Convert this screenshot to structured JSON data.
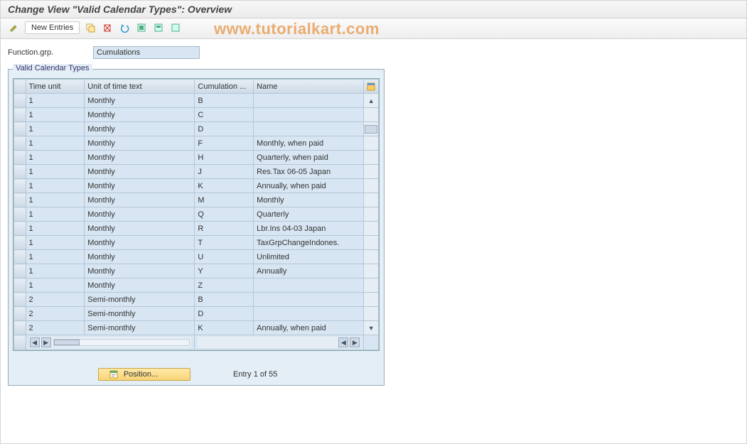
{
  "title": "Change View \"Valid Calendar Types\": Overview",
  "toolbar": {
    "new_entries": "New Entries"
  },
  "watermark": "www.tutorialkart.com",
  "field": {
    "label": "Function.grp.",
    "value": "Cumulations"
  },
  "groupbox_title": "Valid Calendar Types",
  "columns": {
    "time_unit": "Time unit",
    "unit_text": "Unit of time text",
    "cumulation": "Cumulation ...",
    "name": "Name"
  },
  "rows": [
    {
      "tu": "1",
      "ut": "Monthly",
      "cu": "B",
      "nm": ""
    },
    {
      "tu": "1",
      "ut": "Monthly",
      "cu": "C",
      "nm": ""
    },
    {
      "tu": "1",
      "ut": "Monthly",
      "cu": "D",
      "nm": ""
    },
    {
      "tu": "1",
      "ut": "Monthly",
      "cu": "F",
      "nm": "Monthly, when paid"
    },
    {
      "tu": "1",
      "ut": "Monthly",
      "cu": "H",
      "nm": "Quarterly, when paid"
    },
    {
      "tu": "1",
      "ut": "Monthly",
      "cu": "J",
      "nm": "Res.Tax 06-05  Japan"
    },
    {
      "tu": "1",
      "ut": "Monthly",
      "cu": "K",
      "nm": "Annually, when paid"
    },
    {
      "tu": "1",
      "ut": "Monthly",
      "cu": "M",
      "nm": "Monthly"
    },
    {
      "tu": "1",
      "ut": "Monthly",
      "cu": "Q",
      "nm": "Quarterly"
    },
    {
      "tu": "1",
      "ut": "Monthly",
      "cu": "R",
      "nm": "Lbr.Ins 04-03  Japan"
    },
    {
      "tu": "1",
      "ut": "Monthly",
      "cu": "T",
      "nm": "TaxGrpChangeIndones."
    },
    {
      "tu": "1",
      "ut": "Monthly",
      "cu": "U",
      "nm": "Unlimited"
    },
    {
      "tu": "1",
      "ut": "Monthly",
      "cu": "Y",
      "nm": "Annually"
    },
    {
      "tu": "1",
      "ut": "Monthly",
      "cu": "Z",
      "nm": ""
    },
    {
      "tu": "2",
      "ut": "Semi-monthly",
      "cu": "B",
      "nm": ""
    },
    {
      "tu": "2",
      "ut": "Semi-monthly",
      "cu": "D",
      "nm": ""
    },
    {
      "tu": "2",
      "ut": "Semi-monthly",
      "cu": "K",
      "nm": "Annually, when paid"
    }
  ],
  "footer": {
    "position": "Position...",
    "entry": "Entry 1 of 55"
  }
}
